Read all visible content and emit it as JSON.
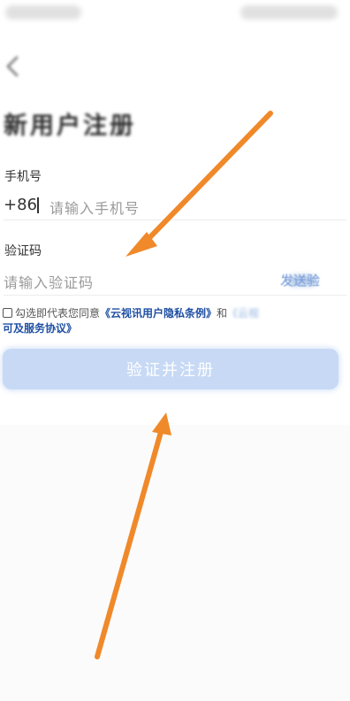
{
  "status_bar": {},
  "header": {
    "title": "新用户注册"
  },
  "phone": {
    "label": "手机号",
    "country_code": "+86",
    "placeholder": "请输入手机号"
  },
  "code": {
    "label": "验证码",
    "placeholder": "请输入验证码",
    "send_label": "发送验"
  },
  "agreement": {
    "prefix": "勾选即代表您同意",
    "privacy_link": "《云视讯用户隐私条例》",
    "connector": "和",
    "service_link_visible": "《云视",
    "service_link_cont": "可及服务协议》"
  },
  "submit_label": "验证并注册",
  "colors": {
    "button_bg": "#c7d9f5",
    "link": "#1f4fa3",
    "arrow": "#f0892a"
  }
}
